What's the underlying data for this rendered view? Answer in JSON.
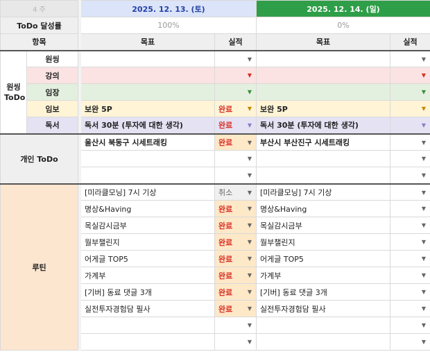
{
  "header": {
    "week_label": "4 주",
    "day1_date": "2025. 12. 13. (토)",
    "day2_date": "2025. 12. 14. (일)"
  },
  "achievement": {
    "label": "ToDo 달성률",
    "day1": "100%",
    "day2": "0%"
  },
  "columns": {
    "item": "항목",
    "goal": "목표",
    "result": "실적"
  },
  "groups": {
    "wonssing": "원씽\nToDo",
    "personal": "개인 ToDo",
    "routine": "루틴"
  },
  "wonssing_rows": [
    {
      "category": "원씽",
      "d1_goal": "",
      "d1_result": "",
      "d2_goal": "",
      "d2_result": ""
    },
    {
      "category": "강의",
      "d1_goal": "",
      "d1_result": "",
      "d2_goal": "",
      "d2_result": ""
    },
    {
      "category": "임장",
      "d1_goal": "",
      "d1_result": "",
      "d2_goal": "",
      "d2_result": ""
    },
    {
      "category": "임보",
      "d1_goal": "보완 5P",
      "d1_result": "완료",
      "d2_goal": "보완 5P",
      "d2_result": ""
    },
    {
      "category": "독서",
      "d1_goal": "독서 30분 (투자에 대한 생각)",
      "d1_result": "완료",
      "d2_goal": "독서 30분 (투자에 대한 생각)",
      "d2_result": ""
    }
  ],
  "personal_rows": [
    {
      "d1_goal": "울산시 북동구 시세트래킹",
      "d1_result": "완료",
      "d2_goal": "부산시 부산진구 시세트래킹",
      "d2_result": ""
    },
    {
      "d1_goal": "",
      "d1_result": "",
      "d2_goal": "",
      "d2_result": ""
    },
    {
      "d1_goal": "",
      "d1_result": "",
      "d2_goal": "",
      "d2_result": ""
    }
  ],
  "routine_rows": [
    {
      "d1_goal": "[미라클모닝] 7시 기상",
      "d1_result": "취소",
      "d2_goal": "[미라클모닝] 7시 기상",
      "d2_result": ""
    },
    {
      "d1_goal": "명상&Having",
      "d1_result": "완료",
      "d2_goal": "명상&Having",
      "d2_result": ""
    },
    {
      "d1_goal": "목실감시금부",
      "d1_result": "완료",
      "d2_goal": "목실감시금부",
      "d2_result": ""
    },
    {
      "d1_goal": "월부챌린지",
      "d1_result": "완료",
      "d2_goal": "월부챌린지",
      "d2_result": ""
    },
    {
      "d1_goal": "어게글 TOP5",
      "d1_result": "완료",
      "d2_goal": "어게글 TOP5",
      "d2_result": ""
    },
    {
      "d1_goal": "가계부",
      "d1_result": "완료",
      "d2_goal": "가계부",
      "d2_result": ""
    },
    {
      "d1_goal": "[기버] 동료 댓글 3개",
      "d1_result": "완료",
      "d2_goal": "[기버] 동료 댓글 3개",
      "d2_result": ""
    },
    {
      "d1_goal": "실전투자경험담 필사",
      "d1_result": "완료",
      "d2_goal": "실전투자경험담 필사",
      "d2_result": ""
    },
    {
      "d1_goal": "",
      "d1_result": "",
      "d2_goal": "",
      "d2_result": ""
    },
    {
      "d1_goal": "",
      "d1_result": "",
      "d2_goal": "",
      "d2_result": ""
    }
  ],
  "icons": {
    "dropdown": "dropdown-arrow-icon"
  },
  "colors": {
    "day1_header_bg": "#dbe4f8",
    "day2_header_bg": "#2f9e49",
    "done_text": "#d93025",
    "done_bg": "#fde8c8",
    "routine_bg": "#fce6d0"
  }
}
